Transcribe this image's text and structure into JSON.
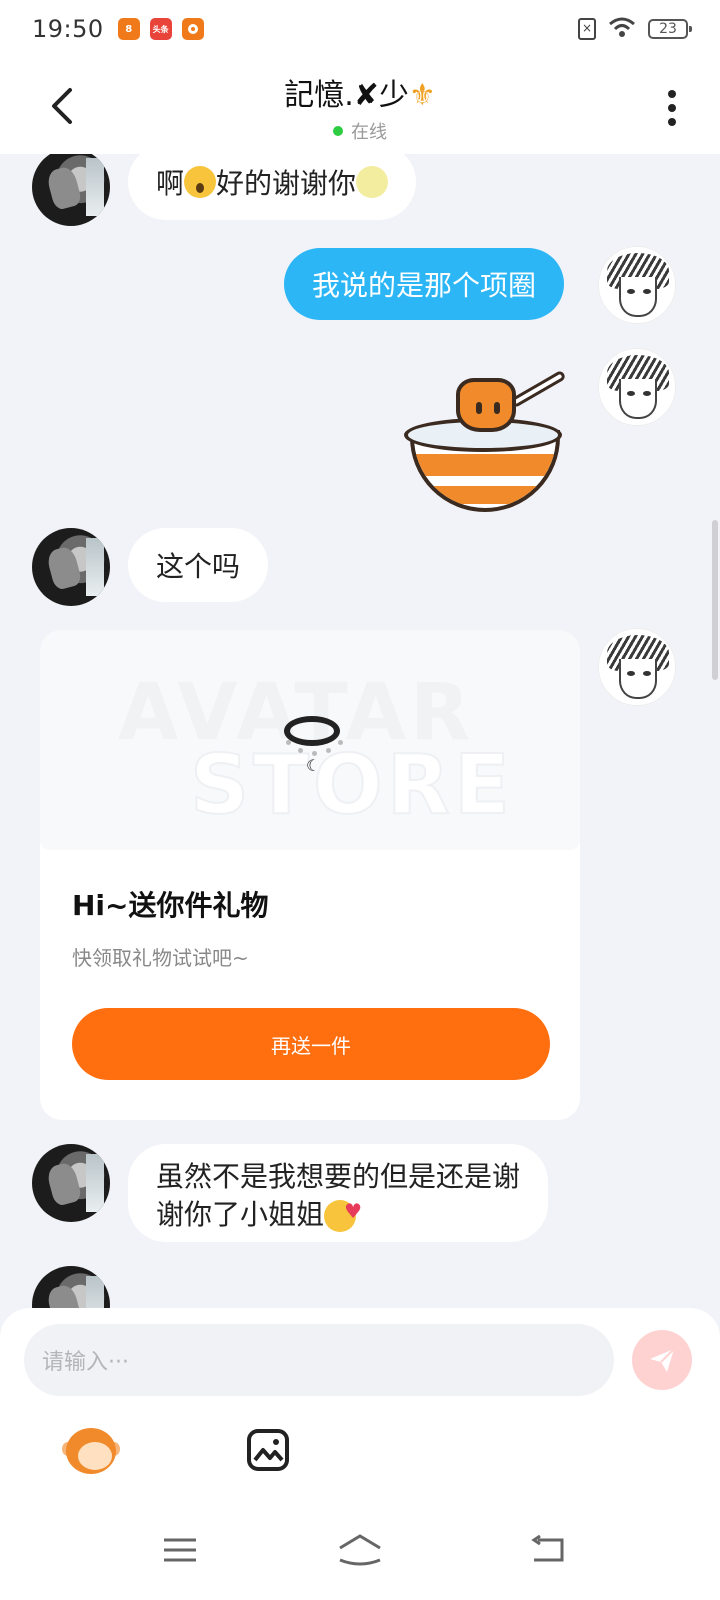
{
  "status_bar": {
    "time": "19:50",
    "battery": "23",
    "apps": [
      {
        "name": "app-icon-1",
        "color": "#f07a1a",
        "label": "8"
      },
      {
        "name": "app-icon-2",
        "color": "#e8443a",
        "label": "头条"
      },
      {
        "name": "app-icon-3",
        "color": "#f07a1a",
        "label": ""
      }
    ]
  },
  "header": {
    "title": "記憶.✘少",
    "title_suffix": "⚜",
    "status": "在线"
  },
  "messages": [
    {
      "id": "m1",
      "side": "left",
      "text_before": "啊",
      "text_mid": "好的谢谢你",
      "emoji_1": "astonished-face",
      "emoji_2": "moon-face"
    },
    {
      "id": "m2",
      "side": "right",
      "text": "我说的是那个项圈"
    },
    {
      "id": "m3",
      "side": "right",
      "type": "sticker",
      "sticker": "cat-in-bowl-sticker"
    },
    {
      "id": "m4",
      "side": "left",
      "text": "这个吗"
    },
    {
      "id": "m5",
      "side": "left",
      "text_lines": [
        "虽然不是我想要的但是还是谢",
        "谢你了小姐姐"
      ],
      "emoji": "smiling-face-with-hearts"
    }
  ],
  "gift_card": {
    "watermark_line1": "AVATAR",
    "watermark_line2": "STORE",
    "title": "Hi~送你件礼物",
    "subtitle": "快领取礼物试试吧~",
    "button": "再送一件",
    "accent": "#ff6f10"
  },
  "input": {
    "placeholder": "请输入···"
  },
  "colors": {
    "my_bubble": "#2cb6f6",
    "background": "#f2f3f8",
    "send_button": "#ffd2d2"
  }
}
